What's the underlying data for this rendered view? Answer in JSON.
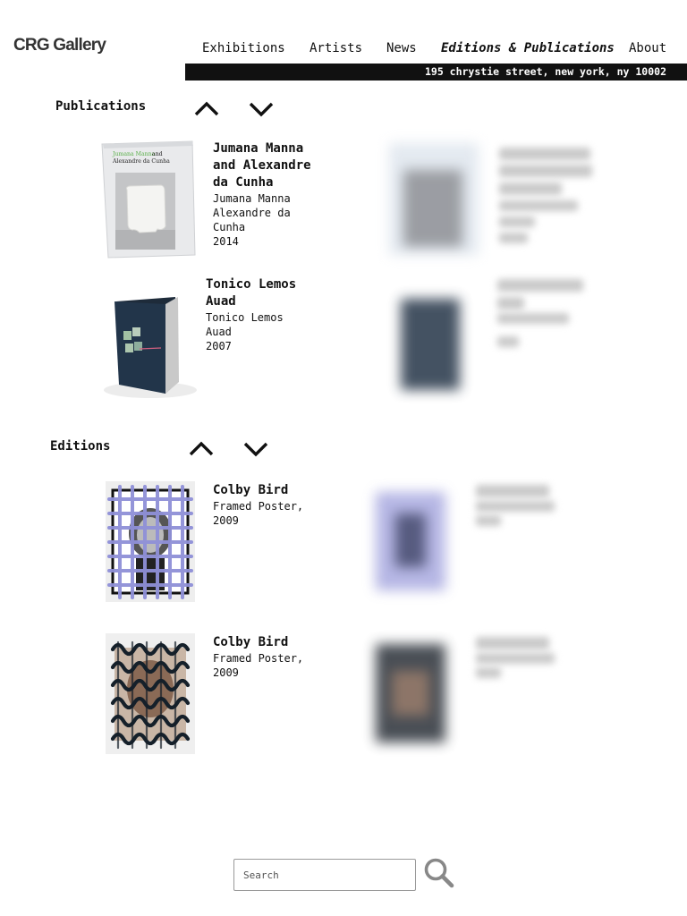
{
  "site": {
    "logo": "CRG Gallery"
  },
  "nav": {
    "items": [
      {
        "label": "Exhibitions"
      },
      {
        "label": "Artists"
      },
      {
        "label": "News"
      },
      {
        "label": "Editions & Publications"
      },
      {
        "label": "About"
      }
    ]
  },
  "address": "195 chrystie street, new york, ny 10002",
  "publications": {
    "title": "Publications",
    "items": [
      {
        "title": "Jumana Manna and Alexandre da Cunha",
        "author": "Jumana Manna Alexandre da Cunha",
        "year": "2014",
        "cover_text_green": "Jumana Manna",
        "cover_text_and": "and",
        "cover_text_black": "Alexandre da Cunha"
      },
      {
        "title": "Tonico Lemos Auad",
        "author": "Tonico Lemos Auad",
        "year": "2007"
      }
    ]
  },
  "editions": {
    "title": "Editions",
    "items": [
      {
        "title": "Colby Bird",
        "meta": "Framed Poster, 2009"
      },
      {
        "title": "Colby Bird",
        "meta": "Framed Poster, 2009"
      }
    ]
  },
  "search": {
    "placeholder": "Search"
  },
  "colors": {
    "accent_green": "#5bb04a",
    "dark": "#111111",
    "grid_blue": "#8f90d8"
  },
  "icons": [
    "chevron-up-icon",
    "chevron-down-icon",
    "search-icon"
  ]
}
